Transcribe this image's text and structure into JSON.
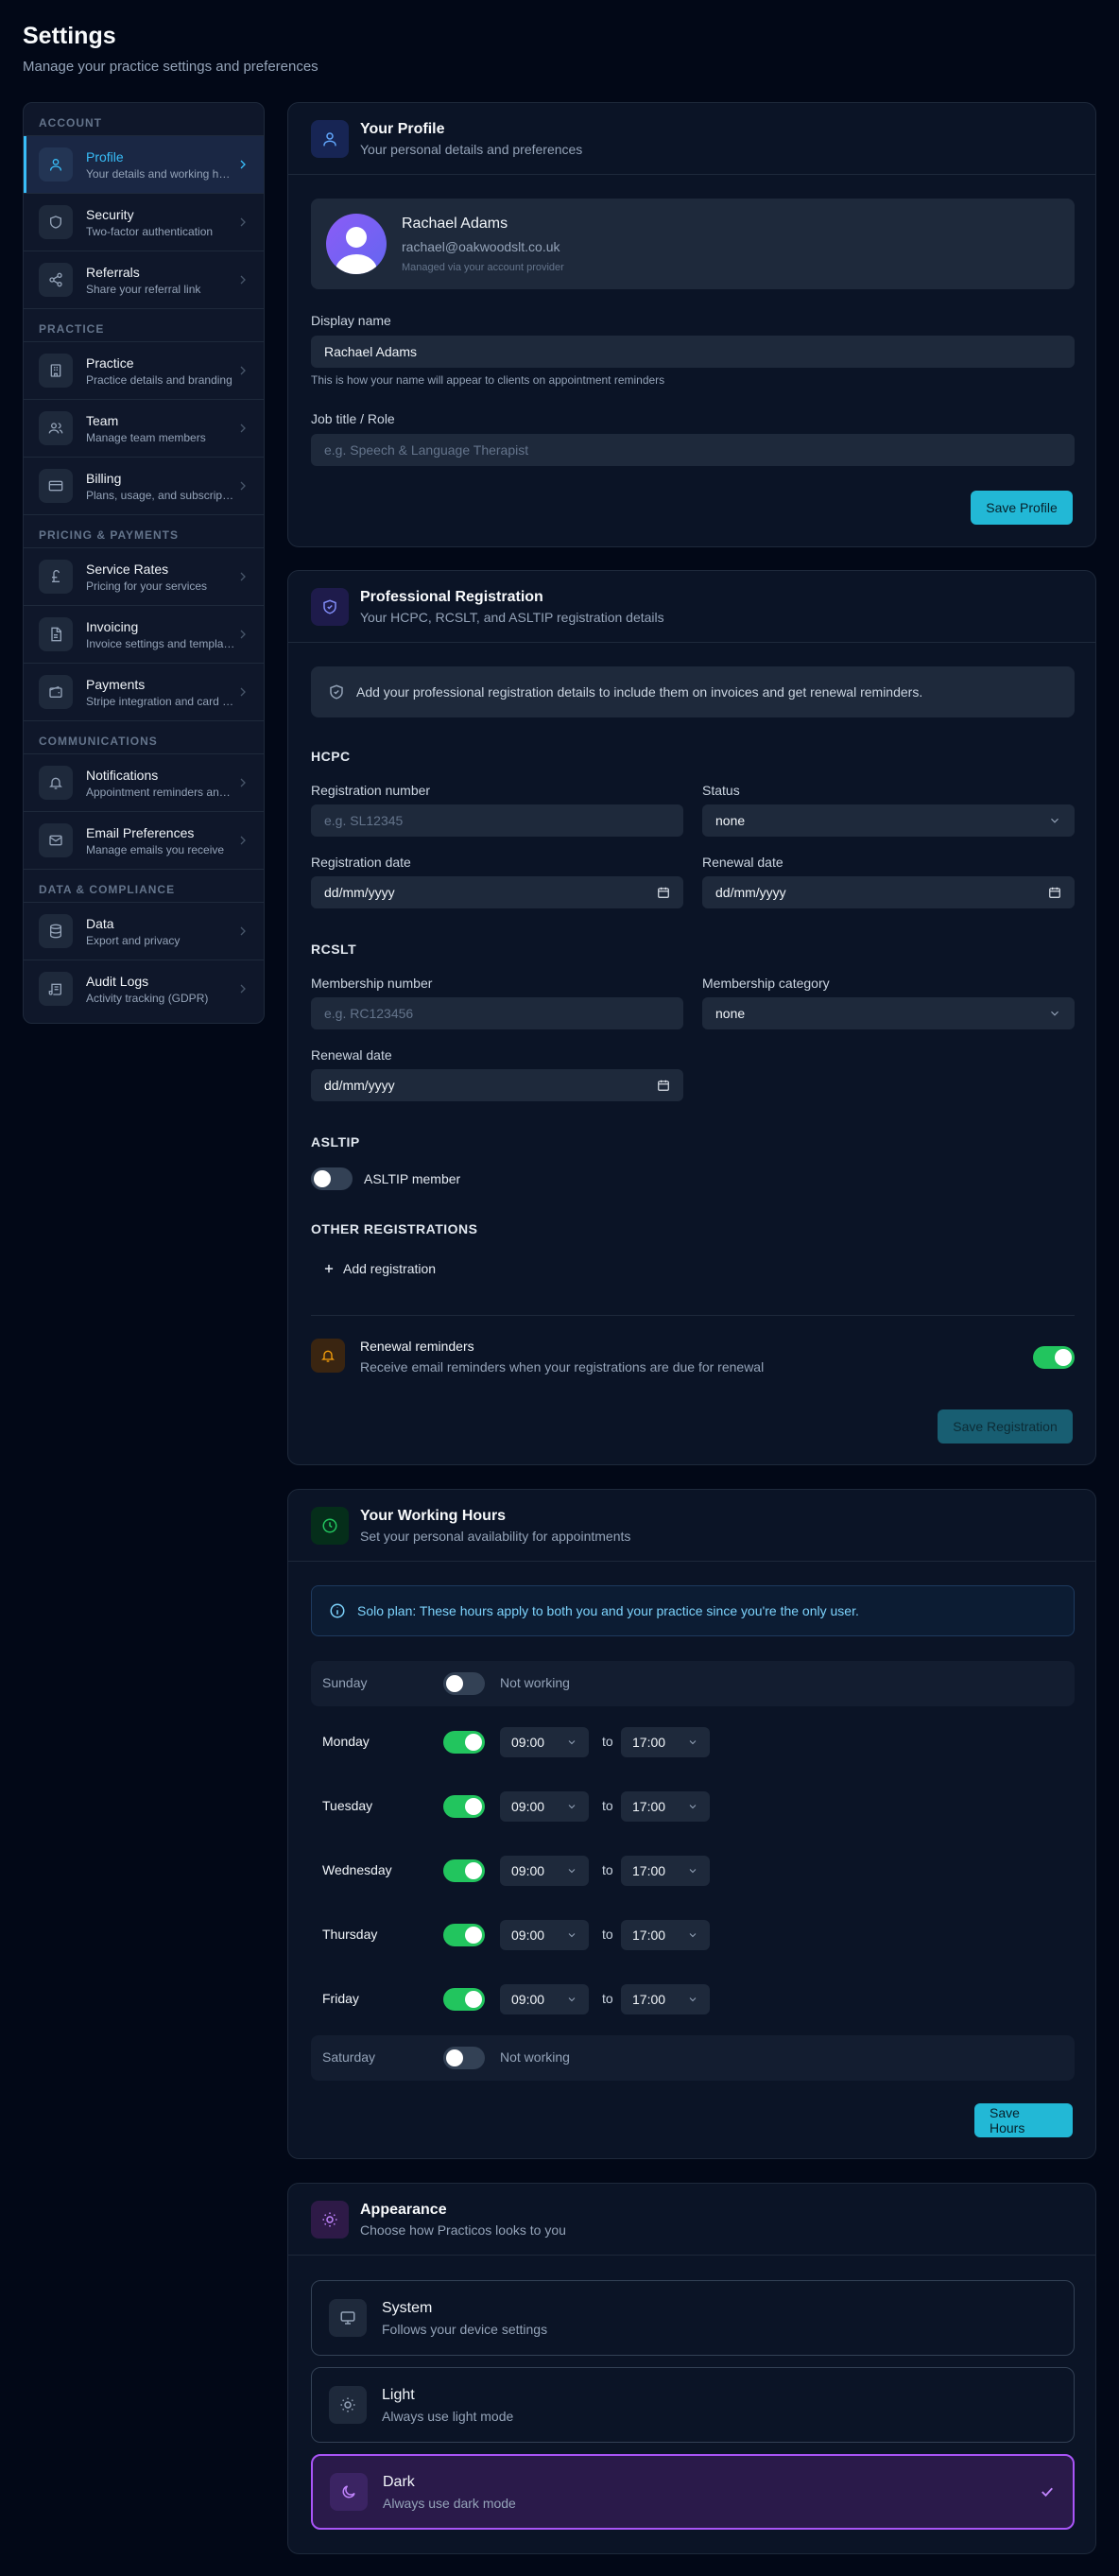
{
  "header": {
    "title": "Settings",
    "subtitle": "Manage your practice settings and preferences"
  },
  "sidebar": {
    "sections": [
      {
        "title": "ACCOUNT",
        "items": [
          {
            "label": "Profile",
            "desc": "Your details and working hours",
            "icon": "user-icon",
            "active": true
          },
          {
            "label": "Security",
            "desc": "Two-factor authentication",
            "icon": "shield-icon"
          },
          {
            "label": "Referrals",
            "desc": "Share your referral link",
            "icon": "share-icon"
          }
        ]
      },
      {
        "title": "PRACTICE",
        "items": [
          {
            "label": "Practice",
            "desc": "Practice details and branding",
            "icon": "building-icon"
          },
          {
            "label": "Team",
            "desc": "Manage team members",
            "icon": "users-icon"
          },
          {
            "label": "Billing",
            "desc": "Plans, usage, and subscription",
            "icon": "credit-card-icon"
          }
        ]
      },
      {
        "title": "PRICING & PAYMENTS",
        "items": [
          {
            "label": "Service Rates",
            "desc": "Pricing for your services",
            "icon": "pound-icon"
          },
          {
            "label": "Invoicing",
            "desc": "Invoice settings and templates",
            "icon": "file-icon"
          },
          {
            "label": "Payments",
            "desc": "Stripe integration and card payments",
            "icon": "wallet-icon"
          }
        ]
      },
      {
        "title": "COMMUNICATIONS",
        "items": [
          {
            "label": "Notifications",
            "desc": "Appointment reminders and alerts",
            "icon": "bell-icon"
          },
          {
            "label": "Email Preferences",
            "desc": "Manage emails you receive",
            "icon": "mail-icon"
          }
        ]
      },
      {
        "title": "DATA & COMPLIANCE",
        "items": [
          {
            "label": "Data",
            "desc": "Export and privacy",
            "icon": "database-icon"
          },
          {
            "label": "Audit Logs",
            "desc": "Activity tracking (GDPR)",
            "icon": "scroll-icon"
          }
        ]
      }
    ]
  },
  "profile": {
    "title": "Your Profile",
    "subtitle": "Your personal details and preferences",
    "name": "Rachael Adams",
    "email": "rachael@oakwoodslt.co.uk",
    "managed": "Managed via your account provider",
    "display_name_label": "Display name",
    "display_name_value": "Rachael Adams",
    "display_name_help": "This is how your name will appear to clients on appointment reminders",
    "job_title_label": "Job title / Role",
    "job_title_placeholder": "e.g. Speech & Language Therapist",
    "save_label": "Save Profile"
  },
  "registration": {
    "title": "Professional Registration",
    "subtitle": "Your HCPC, RCSLT, and ASLTIP registration details",
    "notice": "Add your professional registration details to include them on invoices and get renewal reminders.",
    "hcpc": {
      "heading": "HCPC",
      "reg_number_label": "Registration number",
      "reg_number_placeholder": "e.g. SL12345",
      "status_label": "Status",
      "status_value": "none",
      "reg_date_label": "Registration date",
      "reg_date_value": "dd/mm/yyyy",
      "renewal_label": "Renewal date",
      "renewal_value": "dd/mm/yyyy"
    },
    "rcslt": {
      "heading": "RCSLT",
      "membership_number_label": "Membership number",
      "membership_number_placeholder": "e.g. RC123456",
      "category_label": "Membership category",
      "category_value": "none",
      "renewal_label": "Renewal date",
      "renewal_value": "dd/mm/yyyy"
    },
    "asltip": {
      "heading": "ASLTIP",
      "member_label": "ASLTIP member",
      "member": false
    },
    "other": {
      "heading": "OTHER REGISTRATIONS",
      "add_label": "Add registration"
    },
    "reminders": {
      "title": "Renewal reminders",
      "desc": "Receive email reminders when your registrations are due for renewal",
      "enabled": true
    },
    "save_label": "Save Registration"
  },
  "hours": {
    "title": "Your Working Hours",
    "subtitle": "Set your personal availability for appointments",
    "notice": "Solo plan: These hours apply to both you and your practice since you're the only user.",
    "to_label": "to",
    "not_working_label": "Not working",
    "days": [
      {
        "name": "Sunday",
        "working": false
      },
      {
        "name": "Monday",
        "working": true,
        "start": "09:00",
        "end": "17:00"
      },
      {
        "name": "Tuesday",
        "working": true,
        "start": "09:00",
        "end": "17:00"
      },
      {
        "name": "Wednesday",
        "working": true,
        "start": "09:00",
        "end": "17:00"
      },
      {
        "name": "Thursday",
        "working": true,
        "start": "09:00",
        "end": "17:00"
      },
      {
        "name": "Friday",
        "working": true,
        "start": "09:00",
        "end": "17:00"
      },
      {
        "name": "Saturday",
        "working": false
      }
    ],
    "save_label": "Save Hours"
  },
  "appearance": {
    "title": "Appearance",
    "subtitle": "Choose how Practicos looks to you",
    "options": [
      {
        "label": "System",
        "desc": "Follows your device settings",
        "icon": "monitor-icon",
        "selected": false
      },
      {
        "label": "Light",
        "desc": "Always use light mode",
        "icon": "sun-icon",
        "selected": false
      },
      {
        "label": "Dark",
        "desc": "Always use dark mode",
        "icon": "moon-icon",
        "selected": true
      }
    ]
  },
  "colors": {
    "accent": "#22b8d6",
    "active_nav": "#38bdf8",
    "toggle_on": "#22c55e",
    "selected_theme": "#a855f7"
  }
}
